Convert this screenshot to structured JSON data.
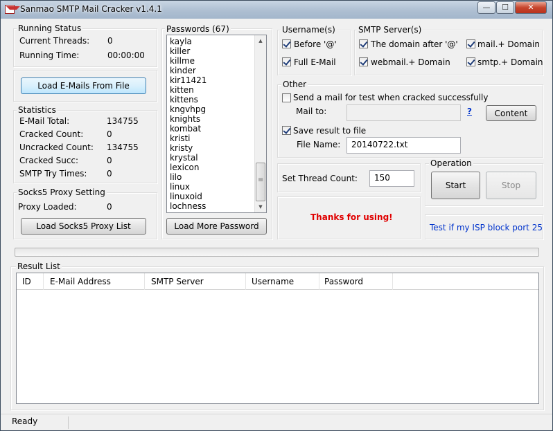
{
  "window": {
    "title": "Sanmao SMTP Mail Cracker v1.4.1"
  },
  "titlebar_buttons": {
    "minimize": "—",
    "maximize": "☐",
    "close": "✕"
  },
  "running_status": {
    "title": "Running Status",
    "current_threads_label": "Current Threads:",
    "current_threads_value": "0",
    "running_time_label": "Running Time:",
    "running_time_value": "00:00:00"
  },
  "load_emails_button": "Load E-Mails From File",
  "statistics": {
    "title": "Statistics",
    "rows": [
      {
        "label": "E-Mail Total:",
        "value": "134755"
      },
      {
        "label": "Cracked Count:",
        "value": "0"
      },
      {
        "label": "Uncracked Count:",
        "value": "134755"
      },
      {
        "label": "Cracked Succ:",
        "value": "0"
      },
      {
        "label": "SMTP Try Times:",
        "value": "0"
      }
    ]
  },
  "socks5": {
    "title": "Socks5 Proxy Setting",
    "proxy_loaded_label": "Proxy Loaded:",
    "proxy_loaded_value": "0",
    "load_button": "Load Socks5 Proxy List"
  },
  "passwords": {
    "title": "Passwords (67)",
    "items": [
      "kayla",
      "killer",
      "killme",
      "kinder",
      "kir11421",
      "kitten",
      "kittens",
      "kngvhpg",
      "knights",
      "kombat",
      "kristi",
      "kristy",
      "krystal",
      "lexicon",
      "lilo",
      "linux",
      "linuxoid",
      "lochness"
    ],
    "load_more_button": "Load More Password"
  },
  "username": {
    "title": "Username(s)",
    "before_at": {
      "label": "Before '@'",
      "checked": true
    },
    "full_email": {
      "label": "Full E-Mail",
      "checked": true
    }
  },
  "smtp_servers": {
    "title": "SMTP Server(s)",
    "domain_after_at": {
      "label": "The domain after '@'",
      "checked": true
    },
    "mail_domain": {
      "label": "mail.+ Domain",
      "checked": true
    },
    "webmail_domain": {
      "label": "webmail.+ Domain",
      "checked": true
    },
    "smtp_domain": {
      "label": "smtp.+ Domain",
      "checked": true
    }
  },
  "other": {
    "title": "Other",
    "send_test": {
      "label": "Send a mail for test when cracked successfully",
      "checked": false
    },
    "mail_to_label": "Mail to:",
    "mail_to_value": "",
    "help_link": "?",
    "content_button": "Content",
    "save_result": {
      "label": "Save result to file",
      "checked": true
    },
    "file_name_label": "File Name:",
    "file_name_value": "20140722.txt"
  },
  "thread_count": {
    "label": "Set Thread Count:",
    "value": "150"
  },
  "operation": {
    "title": "Operation",
    "start_button": "Start",
    "stop_button": "Stop"
  },
  "message": "Thanks for using!",
  "isp_link": "Test if my ISP block port 25",
  "progress": {
    "value": 0
  },
  "result_list": {
    "title": "Result List",
    "columns": [
      "ID",
      "E-Mail Address",
      "SMTP Server",
      "Username",
      "Password"
    ]
  },
  "status_bar": {
    "text": "Ready"
  },
  "colors": {
    "title_bar": "#aebfd2",
    "message_red": "#e00000",
    "link_blue": "#0033cc"
  }
}
